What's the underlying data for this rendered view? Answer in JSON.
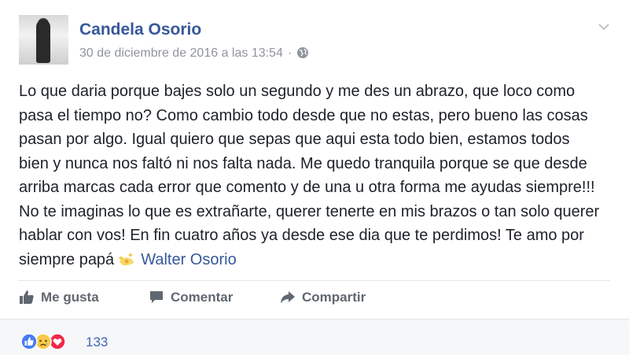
{
  "post": {
    "author_name": "Candela Osorio",
    "timestamp": "30 de diciembre de 2016 a las 13:54",
    "meta_separator": "·",
    "body_main": "Lo que daria porque bajes solo un segundo y me des un abrazo, que loco como pasa el tiempo no? Como cambio todo desde que no estas, pero bueno las cosas pasan por algo. Igual quiero que sepas que aqui esta todo bien, estamos todos bien y nunca nos faltó ni nos falta nada. Me quedo tranquila porque se que desde arriba marcas cada error que comento y de una u otra forma me ayudas siempre!!! No te imaginas lo que es extrañarte, querer tenerte en mis brazos o tan solo querer hablar con vos! En fin cuatro años ya desde ese dia que te perdimos! Te amo por siempre papá",
    "tagged_person": "Walter Osorio",
    "icons": {
      "privacy": "globe-icon",
      "menu": "chevron-down-icon",
      "emoji": "sparkle-emoji-icon"
    }
  },
  "actions": {
    "like_label": "Me gusta",
    "comment_label": "Comentar",
    "share_label": "Compartir"
  },
  "reactions": {
    "types": [
      "like",
      "sad",
      "love"
    ],
    "count": "133"
  },
  "colors": {
    "link": "#365899",
    "meta": "#90949c",
    "action": "#606770",
    "like_blue": "#4a7ef0",
    "love_red": "#f0284a",
    "sad_yellow": "#f7c94a"
  }
}
